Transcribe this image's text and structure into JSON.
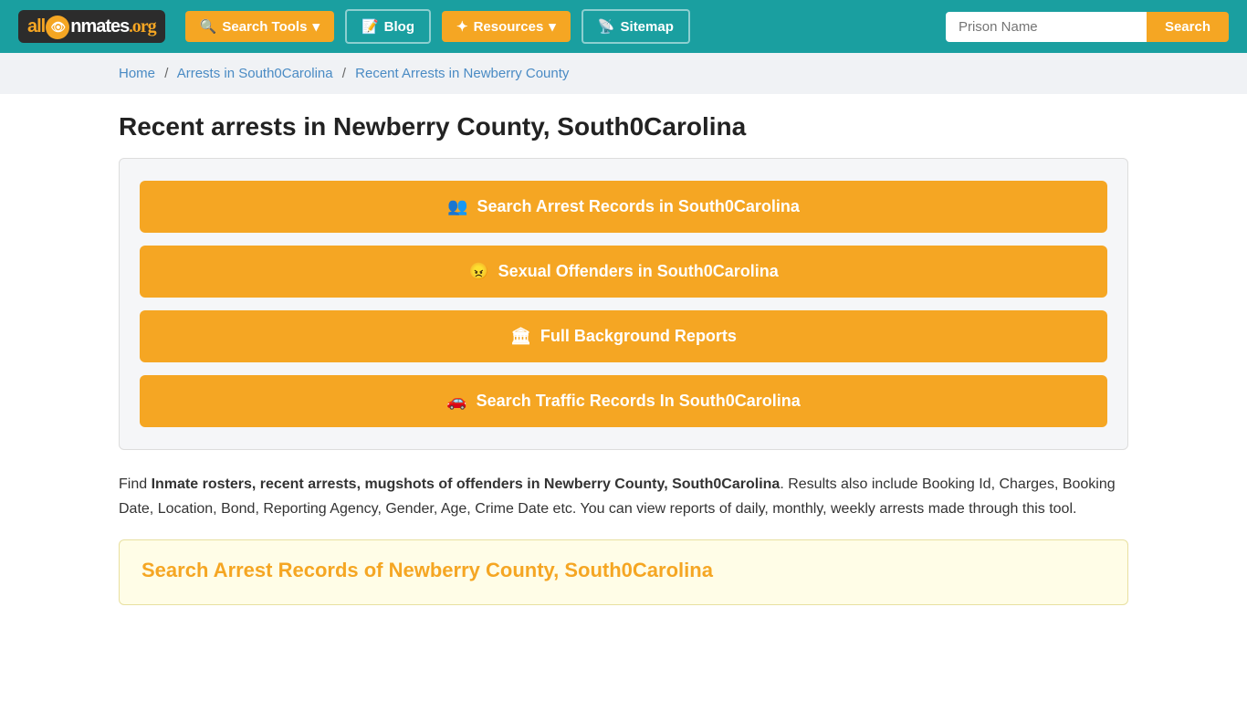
{
  "header": {
    "logo": {
      "text": "all inmates .org"
    },
    "nav": {
      "search_tools": "Search Tools",
      "blog": "Blog",
      "resources": "Resources",
      "sitemap": "Sitemap"
    },
    "search_placeholder": "Prison Name",
    "search_btn": "Search"
  },
  "breadcrumb": {
    "home": "Home",
    "arrests": "Arrests in South0Carolina",
    "current": "Recent Arrests in Newberry County"
  },
  "page": {
    "title": "Recent arrests in Newberry County, South0Carolina",
    "buttons": {
      "arrest_records": "Search Arrest Records in South0Carolina",
      "sexual_offenders": "Sexual Offenders in South0Carolina",
      "background_reports": "Full Background Reports",
      "traffic_records": "Search Traffic Records In South0Carolina"
    },
    "desc_prefix": "Find ",
    "desc_bold": "Inmate rosters, recent arrests, mugshots of offenders in Newberry County, South0Carolina",
    "desc_suffix": ". Results also include Booking Id, Charges, Booking Date, Location, Bond, Reporting Agency, Gender, Age, Crime Date etc. You can view reports of daily, monthly, weekly arrests made through this tool.",
    "yellow_card_title": "Search Arrest Records of Newberry County, South0Carolina"
  }
}
